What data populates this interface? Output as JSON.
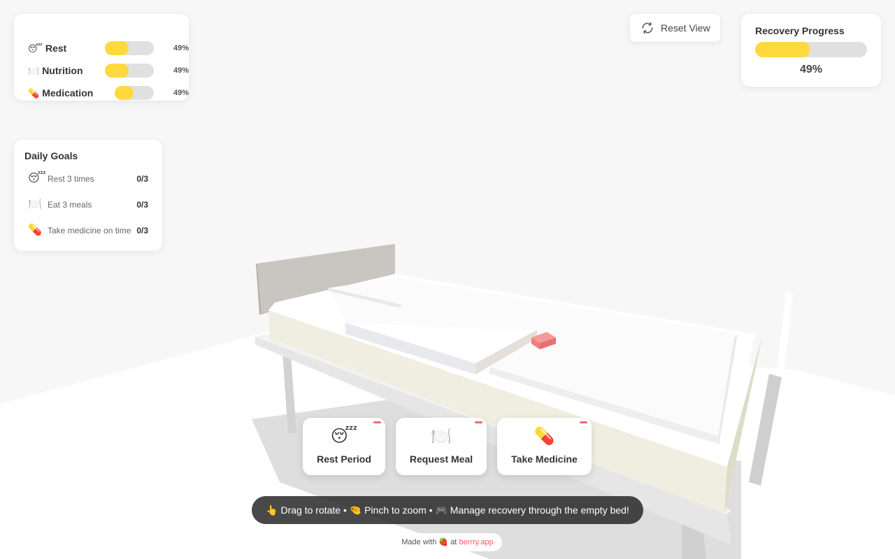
{
  "stats": [
    {
      "icon": "😴",
      "label": "Rest",
      "percent_text": "49%",
      "value": 0.49
    },
    {
      "icon": "🍽️",
      "label": "Nutrition",
      "percent_text": "49%",
      "value": 0.49
    },
    {
      "icon": "💊",
      "label": "Medication",
      "percent_text": "49%",
      "value": 0.49
    }
  ],
  "goals": {
    "title": "Daily Goals",
    "items": [
      {
        "icon": "😴",
        "text": "Rest 3 times",
        "count": "0/3"
      },
      {
        "icon": "🍽️",
        "text": "Eat 3 meals",
        "count": "0/3"
      },
      {
        "icon": "💊",
        "text": "Take medicine on time",
        "count": "0/3"
      }
    ]
  },
  "reset_view": {
    "label": "Reset View",
    "icon": "refresh-icon"
  },
  "recovery": {
    "title": "Recovery Progress",
    "percent_text": "49%",
    "value": 0.49
  },
  "actions": [
    {
      "icon": "😴",
      "label": "Rest Period"
    },
    {
      "icon": "🍽️",
      "label": "Request Meal"
    },
    {
      "icon": "💊",
      "label": "Take Medicine"
    }
  ],
  "hint": "👆 Drag to rotate • 🤏 Pinch to zoom • 🎮 Manage recovery through the empty bed!",
  "credit": {
    "prefix": "Made with",
    "heart": "🍓",
    "at": "at",
    "link": "berrry.app"
  },
  "colors": {
    "accent": "#ffd93d",
    "track": "#e0e0e0",
    "badge": "#f26b6b",
    "link": "#ff5a5f"
  }
}
